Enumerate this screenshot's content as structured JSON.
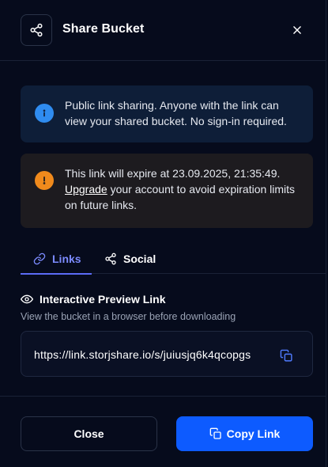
{
  "header": {
    "title": "Share Bucket",
    "share_icon": "share-icon",
    "close_icon": "close-icon"
  },
  "alerts": {
    "info": {
      "icon": "info-icon",
      "color": "#2f8cf0",
      "text": "Public link sharing. Anyone with the link can view your shared bucket. No sign-in required."
    },
    "warning": {
      "icon": "warning-icon",
      "color": "#f08a1c",
      "text_before": "This link will expire at 23.09.2025, 21:35:49.",
      "link_label": "Upgrade",
      "text_after": "your account to avoid expiration limits on future links."
    }
  },
  "tabs": {
    "links": {
      "label": "Links",
      "icon": "link-icon",
      "active": true
    },
    "social": {
      "label": "Social",
      "icon": "share-icon",
      "active": false
    }
  },
  "preview": {
    "title": "Interactive Preview Link",
    "icon": "eye-icon",
    "subtitle": "View the bucket in a browser before downloading",
    "url": "https://link.storjshare.io/s/juiusjq6k4qcopgs",
    "copy_icon": "copy-icon"
  },
  "footer": {
    "close_label": "Close",
    "copy_label": "Copy Link",
    "accent": "#0d5bff"
  }
}
